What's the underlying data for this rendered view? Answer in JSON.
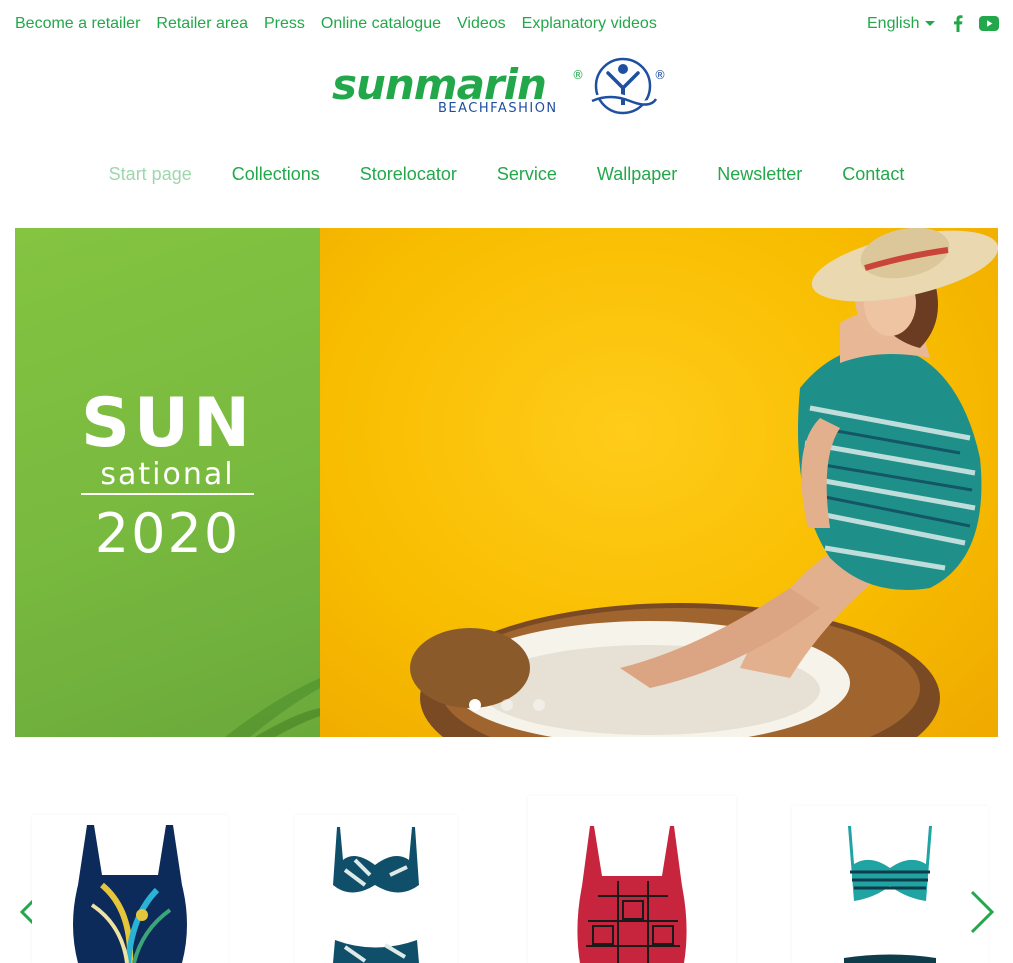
{
  "topnav": {
    "links": [
      "Become a retailer",
      "Retailer area",
      "Press",
      "Online catalogue",
      "Videos",
      "Explanatory videos"
    ],
    "language": "English",
    "social": {
      "facebook_icon": "facebook-icon",
      "youtube_icon": "youtube-icon"
    }
  },
  "logo": {
    "wordmark": "sunmarin",
    "registered": "®",
    "tagline": "BEACHFASHION"
  },
  "mainnav": {
    "items": [
      "Start page",
      "Collections",
      "Storelocator",
      "Service",
      "Wallpaper",
      "Newsletter",
      "Contact"
    ],
    "active_index": 0
  },
  "hero": {
    "title_line1": "SUN",
    "title_line2": "sational",
    "title_year": "2020",
    "slide_count": 3,
    "active_slide": 1
  },
  "products": {
    "items": [
      "swimsuit-peacock-print",
      "bikini-palm-print",
      "swimsuit-red-pattern",
      "bikini-turquoise-stripe"
    ]
  },
  "colors": {
    "brand_green": "#22a84a",
    "hero_green": "#7aba40",
    "hero_yellow": "#f8bd00",
    "logo_blue": "#1f4fa0"
  }
}
